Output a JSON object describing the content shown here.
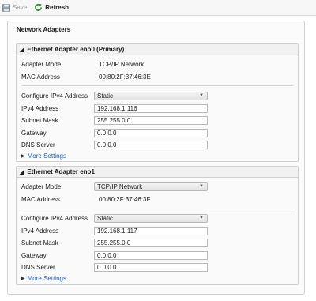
{
  "toolbar": {
    "save_label": "Save",
    "refresh_label": "Refresh"
  },
  "panel": {
    "title": "Network Adapters"
  },
  "adapters": [
    {
      "title": "Ethernet Adapter eno0 (Primary)",
      "adapter_mode_label": "Adapter Mode",
      "adapter_mode_value": "TCP/IP Network",
      "mac_label": "MAC Address",
      "mac_value": "00:80:2F:37:46:3E",
      "configure_label": "Configure IPv4 Address",
      "configure_value": "Static",
      "ipv4_label": "IPv4 Address",
      "ipv4_value": "192.168.1.116",
      "subnet_label": "Subnet Mask",
      "subnet_value": "255.255.0.0",
      "gateway_label": "Gateway",
      "gateway_value": "0.0.0.0",
      "dns_label": "DNS Server",
      "dns_value": "0.0.0.0",
      "more_label": "More Settings"
    },
    {
      "title": "Ethernet Adapter eno1",
      "adapter_mode_label": "Adapter Mode",
      "adapter_mode_value": "TCP/IP Network",
      "mac_label": "MAC Address",
      "mac_value": "00:80:2F:37:46:3F",
      "configure_label": "Configure IPv4 Address",
      "configure_value": "Static",
      "ipv4_label": "IPv4 Address",
      "ipv4_value": "192.168.1.117",
      "subnet_label": "Subnet Mask",
      "subnet_value": "255.255.0.0",
      "gateway_label": "Gateway",
      "gateway_value": "0.0.0.0",
      "dns_label": "DNS Server",
      "dns_value": "0.0.0.0",
      "more_label": "More Settings"
    }
  ],
  "colors": {
    "link": "#1e5aa8",
    "refresh_icon": "#2e8b2e",
    "save_icon_disabled": "#a0a0a0"
  },
  "icons": {
    "save": "save-icon",
    "refresh": "refresh-icon",
    "collapse": "collapse-caret-icon",
    "dropdown": "chevron-down-icon",
    "expand": "expand-triangle-icon"
  }
}
